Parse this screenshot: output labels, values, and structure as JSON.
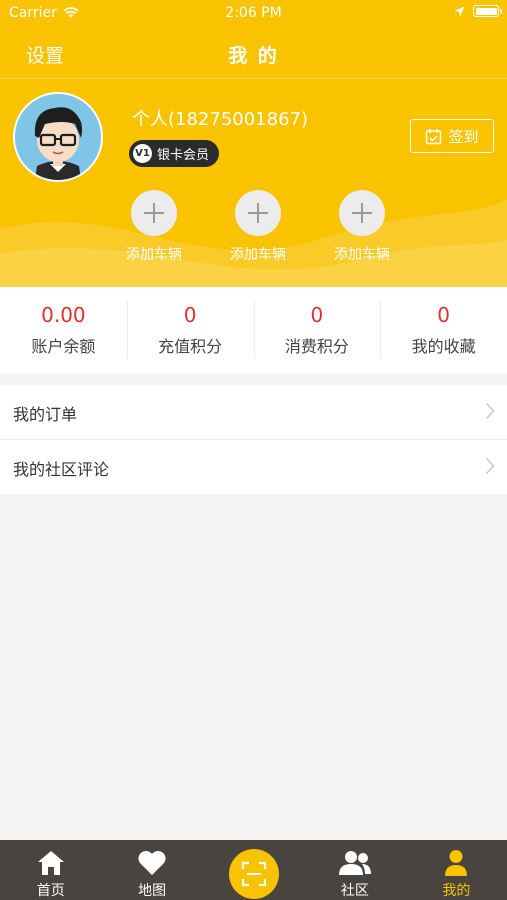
{
  "status_bar": {
    "carrier": "Carrier",
    "time": "2:06 PM",
    "battery_level": 1.0
  },
  "nav": {
    "left_label": "设置",
    "title": "我 的"
  },
  "profile": {
    "name": "个人(18275001867)",
    "badge_icon": "V1",
    "badge_label": "银卡会员",
    "checkin_label": "签到",
    "vehicles": [
      "添加车辆",
      "添加车辆",
      "添加车辆"
    ]
  },
  "stats": [
    {
      "value": "0.00",
      "label": "账户余额"
    },
    {
      "value": "0",
      "label": "充值积分"
    },
    {
      "value": "0",
      "label": "消费积分"
    },
    {
      "value": "0",
      "label": "我的收藏"
    }
  ],
  "menu": [
    {
      "label": "我的订单"
    },
    {
      "label": "我的社区评论"
    }
  ],
  "tabs": [
    {
      "label": "首页",
      "icon": "home-icon"
    },
    {
      "label": "地图",
      "icon": "heart-icon"
    },
    {
      "label": "",
      "icon": "scan-icon"
    },
    {
      "label": "社区",
      "icon": "people-icon"
    },
    {
      "label": "我的",
      "icon": "person-icon"
    }
  ],
  "colors": {
    "brand": "#f9c300",
    "value_red": "#e0312e",
    "tab_bg": "#4a4441"
  }
}
